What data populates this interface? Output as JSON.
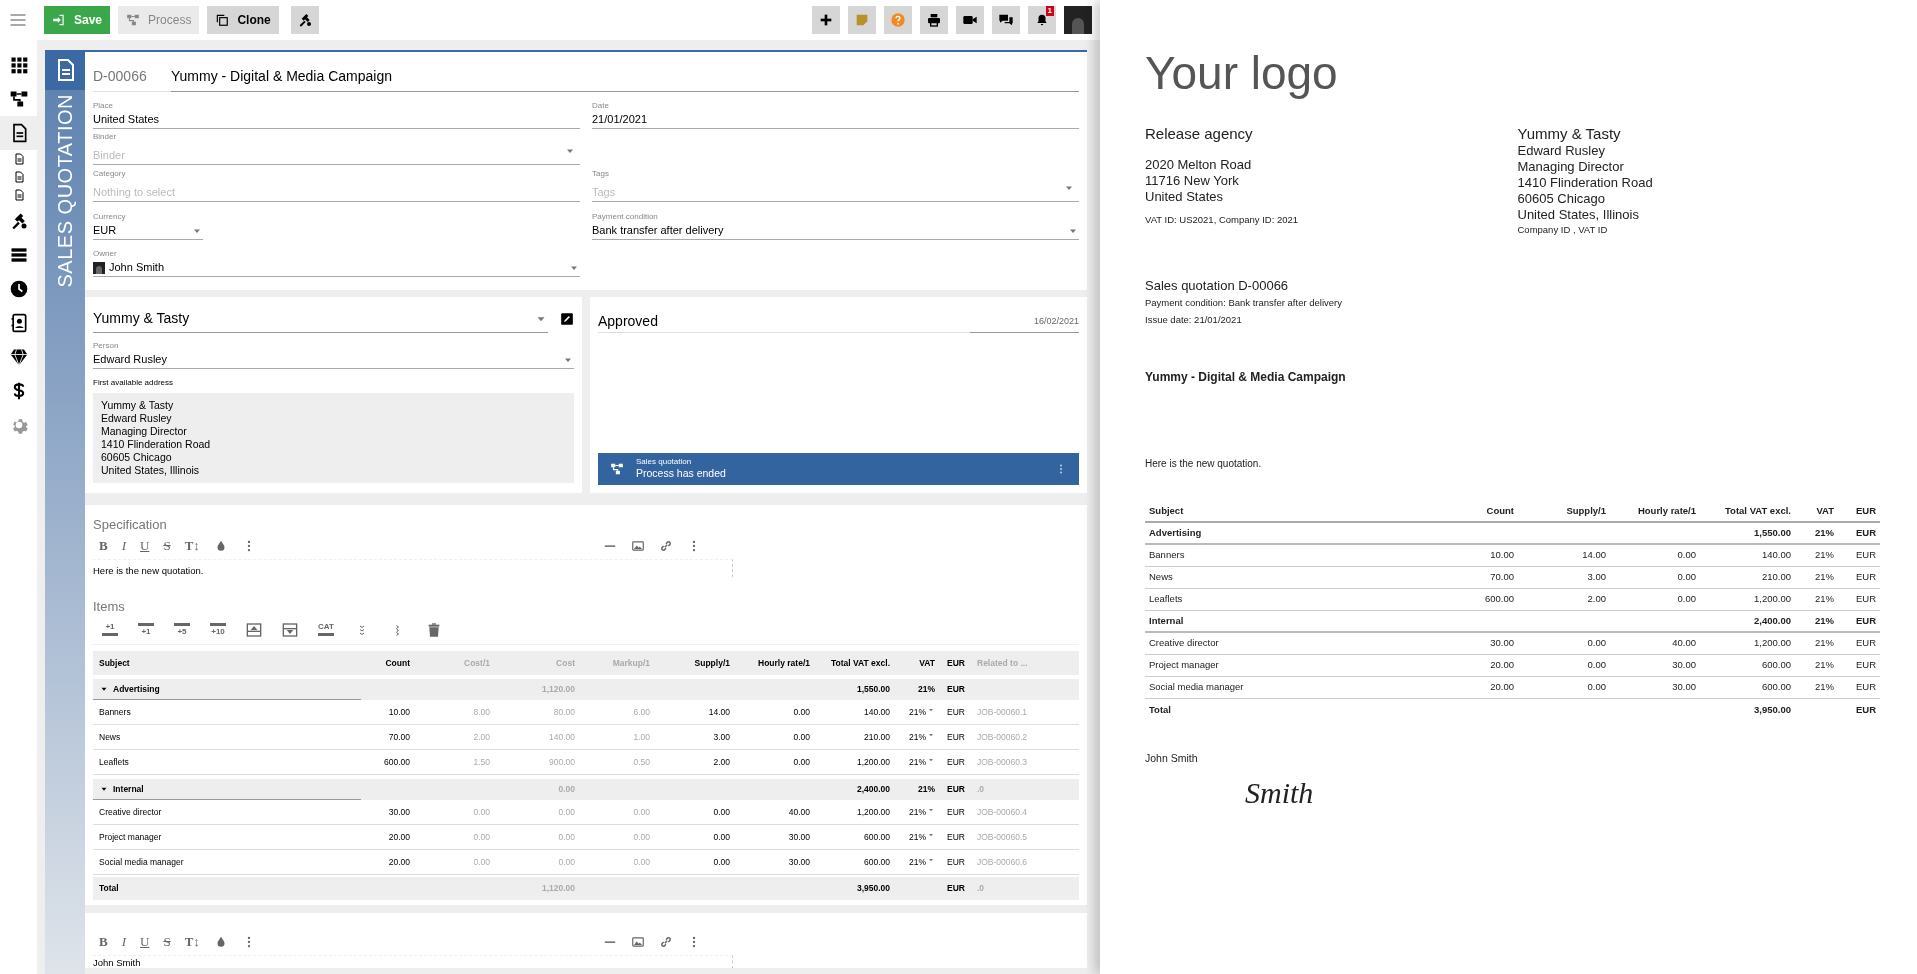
{
  "toolbar": {
    "buttons": [
      {
        "label": "Save",
        "kind": "primary",
        "disabled": false
      },
      {
        "label": "Process",
        "kind": "process",
        "disabled": true
      },
      {
        "label": "Clone",
        "kind": "clone",
        "disabled": false
      }
    ],
    "notification_count": "1"
  },
  "sidebar": {
    "items": [
      {
        "kind": "apps",
        "selected": false
      },
      {
        "kind": "process",
        "selected": false
      },
      {
        "kind": "document",
        "selected": true
      },
      {
        "kind": "subdocument",
        "selected": false
      },
      {
        "kind": "subdocument",
        "selected": false
      },
      {
        "kind": "subdocument",
        "selected": false
      },
      {
        "kind": "tools",
        "selected": false
      },
      {
        "kind": "storage",
        "selected": false
      },
      {
        "kind": "clock",
        "selected": false
      },
      {
        "kind": "contacts",
        "selected": false
      },
      {
        "kind": "diamond",
        "selected": false
      },
      {
        "kind": "dollar",
        "selected": false
      },
      {
        "kind": "settings",
        "selected": false
      }
    ]
  },
  "document": {
    "type_label": "SALES QUOTATION",
    "number": "D-00066",
    "title": "Yummy - Digital & Media Campaign",
    "field_rows": [
      {
        "left": {
          "label": "Place",
          "value": "United States",
          "dropdown": false
        },
        "right": {
          "label": "Date",
          "value": "21/01/2021",
          "dropdown": false
        }
      },
      {
        "left": {
          "label": "Binder",
          "placeholder": "Binder",
          "dropdown": true
        }
      },
      {
        "left": {
          "label": "Category",
          "placeholder": "Nothing to select",
          "dropdown": false
        },
        "right": {
          "label": "Tags",
          "placeholder": "Tags",
          "dropdown": true
        }
      },
      {
        "left": {
          "label": "Currency",
          "value": "EUR",
          "dropdown": true,
          "narrow": true
        },
        "right": {
          "label": "Payment condition",
          "value": "Bank transfer after delivery",
          "dropdown": true
        }
      },
      {
        "left": {
          "label": "Owner",
          "value": "John Smith",
          "dropdown": true,
          "avatar": true
        }
      }
    ]
  },
  "customer": {
    "company": "Yummy & Tasty",
    "person_label": "Person",
    "person": "Edward Rusley",
    "address_label": "First available address",
    "address_lines": [
      "Yummy & Tasty",
      "Edward Rusley",
      "Managing Director",
      "1410 Flinderation Road",
      "60605 Chicago",
      "United States, Illinois"
    ]
  },
  "status": {
    "state": "Approved",
    "date": "16/02/2021",
    "process": {
      "name": "Sales quotation",
      "message": "Process has ended"
    }
  },
  "specification": {
    "heading": "Specification",
    "format_buttons": [
      "B",
      "I",
      "U",
      "S",
      "T↕"
    ],
    "text": "Here is the new quotation."
  },
  "items": {
    "heading": "Items",
    "tools": [
      {
        "kind": "add_top",
        "label": "+1"
      },
      {
        "kind": "add_bottom",
        "label": "+1"
      },
      {
        "kind": "add_bottom",
        "label": "+5"
      },
      {
        "kind": "add_bottom",
        "label": "+10"
      },
      {
        "kind": "row_up"
      },
      {
        "kind": "row_down"
      },
      {
        "kind": "add_top",
        "label": "CAT"
      },
      {
        "kind": "expand"
      },
      {
        "kind": "side"
      },
      {
        "kind": "delete"
      }
    ],
    "columns": [
      {
        "label": "Subject",
        "muted": false
      },
      {
        "label": "Count",
        "muted": false
      },
      {
        "label": "Cost/1",
        "muted": true
      },
      {
        "label": "Cost",
        "muted": true
      },
      {
        "label": "Markup/1",
        "muted": true
      },
      {
        "label": "Supply/1",
        "muted": false
      },
      {
        "label": "Hourly rate/1",
        "muted": false
      },
      {
        "label": "Total VAT excl.",
        "muted": false
      },
      {
        "label": "VAT",
        "muted": false
      },
      {
        "label": "EUR",
        "muted": false
      },
      {
        "label": "Related to ...",
        "muted": true
      }
    ],
    "rows": [
      {
        "kind": "group",
        "expanded": true,
        "cells": [
          "Advertising",
          null,
          null,
          "1,120.00",
          null,
          null,
          null,
          "1,550.00",
          "21%",
          "EUR",
          null
        ]
      },
      {
        "kind": "item",
        "cells": [
          "Banners",
          "10.00",
          "8.00",
          "80.00",
          "6.00",
          "14.00",
          "0.00",
          "140.00",
          "21%",
          "EUR",
          "JOB-00060.1"
        ]
      },
      {
        "kind": "item",
        "cells": [
          "News",
          "70.00",
          "2.00",
          "140.00",
          "1.00",
          "3.00",
          "0.00",
          "210.00",
          "21%",
          "EUR",
          "JOB-00060.2"
        ]
      },
      {
        "kind": "item",
        "cells": [
          "Leaflets",
          "600.00",
          "1.50",
          "900.00",
          "0.50",
          "2.00",
          "0.00",
          "1,200.00",
          "21%",
          "EUR",
          "JOB-00060.3"
        ]
      },
      {
        "kind": "group",
        "expanded": true,
        "cells": [
          "Internal",
          null,
          null,
          "0.00",
          null,
          null,
          null,
          "2,400.00",
          "21%",
          "EUR",
          ".0"
        ]
      },
      {
        "kind": "item",
        "cells": [
          "Creative director",
          "30.00",
          "0.00",
          "0.00",
          "0.00",
          "0.00",
          "40.00",
          "1,200.00",
          "21%",
          "EUR",
          "JOB-00060.4"
        ]
      },
      {
        "kind": "item",
        "cells": [
          "Project manager",
          "20.00",
          "0.00",
          "0.00",
          "0.00",
          "0.00",
          "30.00",
          "600.00",
          "21%",
          "EUR",
          "JOB-00060.5"
        ]
      },
      {
        "kind": "item",
        "cells": [
          "Social media manager",
          "20.00",
          "0.00",
          "0.00",
          "0.00",
          "0.00",
          "30.00",
          "600.00",
          "21%",
          "EUR",
          "JOB-00060.6"
        ]
      },
      {
        "kind": "total",
        "cells": [
          "Total",
          null,
          null,
          "1,120.00",
          null,
          null,
          null,
          "3,950.00",
          null,
          "EUR",
          ".0"
        ]
      }
    ]
  },
  "signature_editor": {
    "format_buttons": [
      "B",
      "I",
      "U",
      "S",
      "T↕"
    ],
    "text": "John Smith"
  },
  "preview": {
    "logo": "Your logo",
    "sender": {
      "name": "Release agency",
      "lines": [
        "2020 Melton Road",
        "11716 New York",
        "United States"
      ],
      "ids": "VAT ID: US2021, Company ID: 2021"
    },
    "recipient": {
      "name": "Yummy & Tasty",
      "lines": [
        "Edward Rusley",
        "Managing Director",
        "1410 Flinderation Road",
        "60605 Chicago",
        "United States, Illinois"
      ],
      "ids": "Company ID , VAT ID"
    },
    "heading": "Sales quotation D-00066",
    "meta": [
      "Payment condition: Bank transfer after delivery",
      "Issue date: 21/01/2021"
    ],
    "subject": "Yummy - Digital & Media Campaign",
    "body": "Here is the new quotation.",
    "columns": [
      "Subject",
      "Count",
      "Supply/1",
      "Hourly rate/1",
      "Total VAT excl.",
      "VAT",
      "EUR"
    ],
    "rows": [
      {
        "kind": "group",
        "cells": [
          "Advertising",
          null,
          null,
          null,
          "1,550.00",
          "21%",
          "EUR"
        ]
      },
      {
        "kind": "item",
        "cells": [
          "Banners",
          "10.00",
          "14.00",
          "0.00",
          "140.00",
          "21%",
          "EUR"
        ]
      },
      {
        "kind": "item",
        "cells": [
          "News",
          "70.00",
          "3.00",
          "0.00",
          "210.00",
          "21%",
          "EUR"
        ]
      },
      {
        "kind": "item",
        "cells": [
          "Leaflets",
          "600.00",
          "2.00",
          "0.00",
          "1,200.00",
          "21%",
          "EUR"
        ]
      },
      {
        "kind": "group",
        "cells": [
          "Internal",
          null,
          null,
          null,
          "2,400.00",
          "21%",
          "EUR"
        ]
      },
      {
        "kind": "item",
        "cells": [
          "Creative director",
          "30.00",
          "0.00",
          "40.00",
          "1,200.00",
          "21%",
          "EUR"
        ]
      },
      {
        "kind": "item",
        "cells": [
          "Project manager",
          "20.00",
          "0.00",
          "30.00",
          "600.00",
          "21%",
          "EUR"
        ]
      },
      {
        "kind": "item",
        "cells": [
          "Social media manager",
          "20.00",
          "0.00",
          "30.00",
          "600.00",
          "21%",
          "EUR"
        ]
      },
      {
        "kind": "total",
        "cells": [
          "Total",
          null,
          null,
          null,
          "3,950.00",
          null,
          "EUR"
        ]
      }
    ],
    "signer": "John Smith",
    "signature": "Smith"
  }
}
